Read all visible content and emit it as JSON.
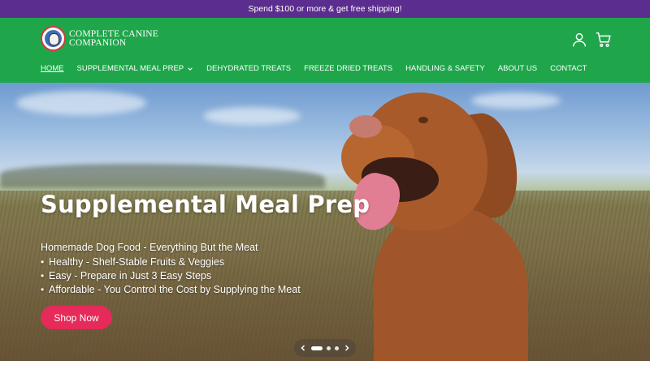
{
  "announcement": {
    "text": "Spend $100 or more & get free shipping!"
  },
  "header": {
    "logo_line1": "COMPLETE CANINE",
    "logo_line2": "COMPANION",
    "account_icon": "user-icon",
    "cart_icon": "cart-icon"
  },
  "nav": {
    "items": [
      {
        "label": "HOME",
        "active": true
      },
      {
        "label": "SUPPLEMENTAL MEAL PREP",
        "has_dropdown": true
      },
      {
        "label": "DEHYDRATED TREATS"
      },
      {
        "label": "FREEZE DRIED TREATS"
      },
      {
        "label": "HANDLING & SAFETY"
      },
      {
        "label": "ABOUT US"
      },
      {
        "label": "CONTACT"
      }
    ]
  },
  "hero": {
    "title": "Supplemental Meal Prep",
    "subtitle": "Homemade Dog Food - Everything But the Meat",
    "bullets": [
      "Healthy - Shelf-Stable Fruits & Veggies",
      "Easy - Prepare in Just 3 Easy Steps",
      "Affordable - You Control the Cost by Supplying the Meat"
    ],
    "cta_label": "Shop Now",
    "slide_count": 3,
    "active_slide": 1
  },
  "colors": {
    "announcement_bg": "#5b2d8e",
    "header_bg": "#1fa64b",
    "cta_bg": "#e62a59"
  }
}
